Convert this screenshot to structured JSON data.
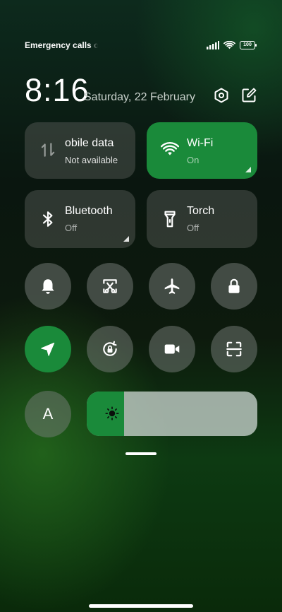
{
  "status_bar": {
    "carrier_text": "Emergency calls o",
    "battery": "100",
    "icons": [
      "signal-icon",
      "wifi-icon",
      "battery-icon"
    ]
  },
  "header": {
    "time": "8:16",
    "date": "Saturday, 22 February",
    "icons": [
      "settings-icon",
      "edit-icon"
    ]
  },
  "tiles": {
    "mobile_data": {
      "name": "obile data",
      "status": "Not available",
      "icon": "mobile-data-icon",
      "active": false
    },
    "wifi": {
      "name": "Wi-Fi",
      "status": "On",
      "icon": "wifi-icon",
      "active": true
    },
    "bluetooth": {
      "name": "Bluetooth",
      "status": "Off",
      "icon": "bluetooth-icon",
      "active": false
    },
    "torch": {
      "name": "Torch",
      "status": "Off",
      "icon": "torch-icon",
      "active": false
    }
  },
  "toggles": [
    {
      "icon": "bell-icon",
      "active": false
    },
    {
      "icon": "screenshot-icon",
      "active": false
    },
    {
      "icon": "airplane-icon",
      "active": false
    },
    {
      "icon": "lock-icon",
      "active": false
    },
    {
      "icon": "location-icon",
      "active": true
    },
    {
      "icon": "rotation-lock-icon",
      "active": false
    },
    {
      "icon": "video-icon",
      "active": false
    },
    {
      "icon": "scan-icon",
      "active": false
    }
  ],
  "bottom": {
    "auto_brightness_label": "A",
    "brightness_level": 0.22
  },
  "colors": {
    "accent": "#1a8a3a",
    "tile_bg": "#3d423f"
  }
}
